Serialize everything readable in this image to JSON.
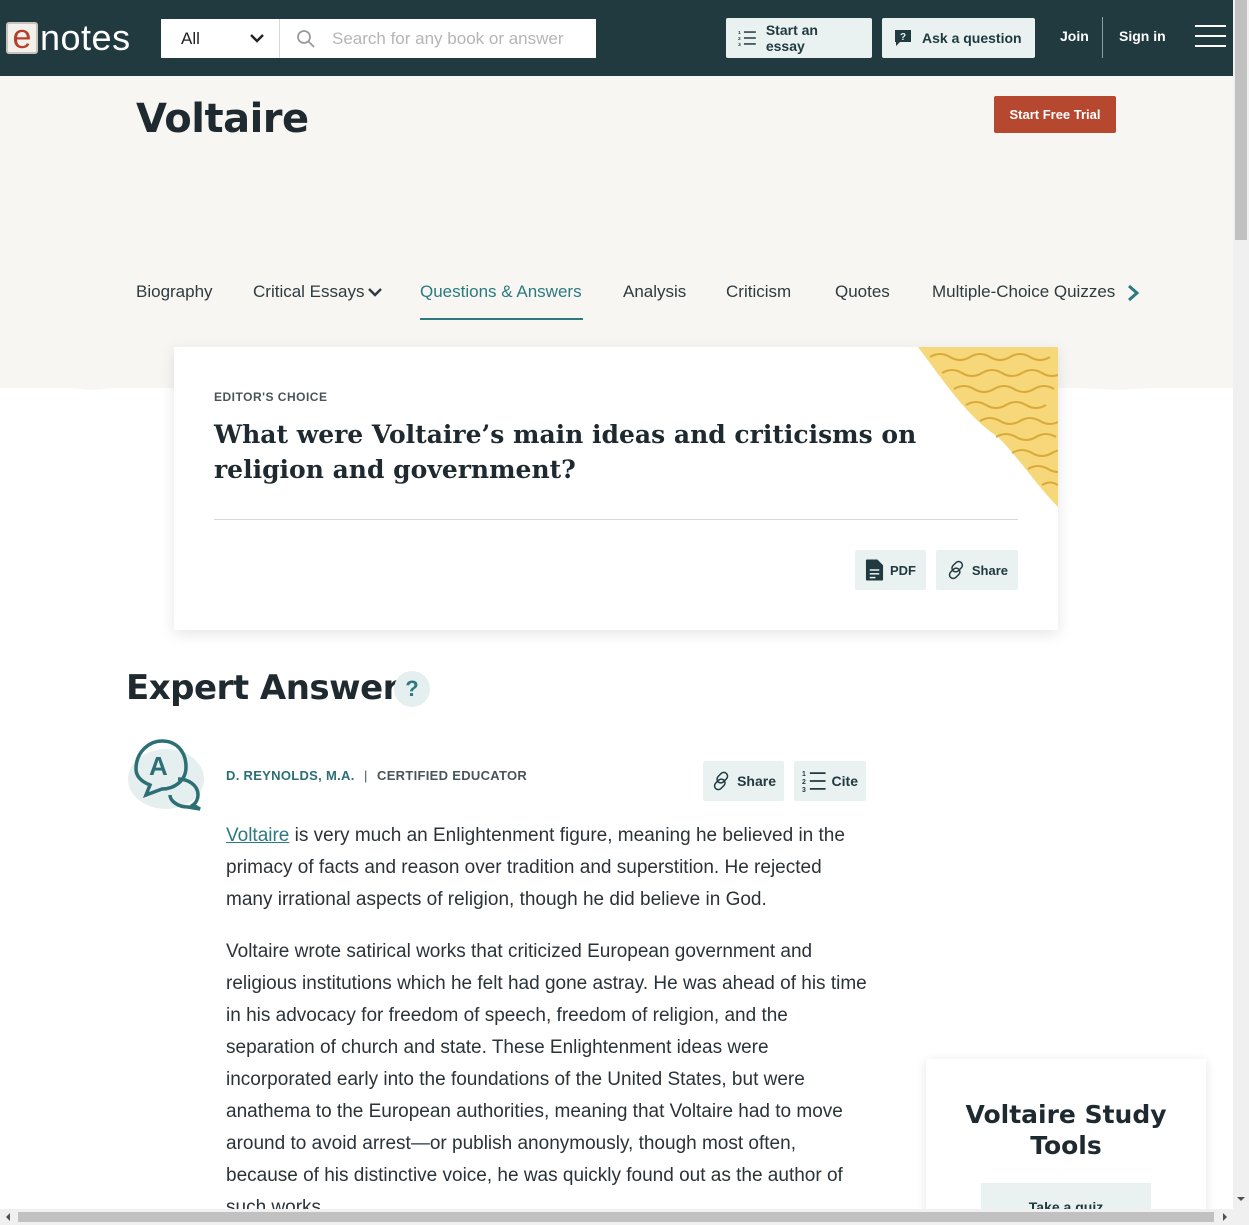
{
  "header": {
    "logo_e": "e",
    "logo_text": "notes",
    "category": "All",
    "search_placeholder": "Search for any book or answer",
    "start_essay": "Start an essay",
    "ask_question": "Ask a question",
    "join": "Join",
    "sign_in": "Sign in"
  },
  "hero": {
    "title": "Voltaire",
    "trial_button": "Start Free Trial",
    "tabs": [
      {
        "label": "Biography"
      },
      {
        "label": "Critical Essays"
      },
      {
        "label": "Questions & Answers"
      },
      {
        "label": "Analysis"
      },
      {
        "label": "Criticism"
      },
      {
        "label": "Quotes"
      },
      {
        "label": "Multiple-Choice Quizzes"
      }
    ]
  },
  "card": {
    "eyebrow": "EDITOR'S CHOICE",
    "question": "What were Voltaire’s main ideas and criticisms on religion and government?",
    "pdf": "PDF",
    "share": "Share"
  },
  "answers": {
    "heading": "Expert Answers",
    "help": "?",
    "avatar_letter": "A",
    "author": "D. REYNOLDS, M.A.",
    "separator": "|",
    "role": "CERTIFIED EDUCATOR",
    "share": "Share",
    "cite": "Cite",
    "p1_link": "Voltaire",
    "p1_rest": " is very much an Enlightenment figure, meaning he believed in the primacy of facts and reason over tradition and superstition. He rejected many irrational aspects of religion, though he did believe in God.",
    "p2": "Voltaire wrote satirical works that criticized European government and religious institutions which he felt had gone astray. He was ahead of his time in his advocacy for freedom of speech, freedom of religion, and the separation of church and state. These Enlightenment ideas were incorporated early into the foundations of the United States, but were anathema to the European authorities, meaning that Voltaire had to move around to avoid arrest—or publish anonymously, though most often, because of his distinctive voice, he was quickly found out as the author of such works."
  },
  "study_tools": {
    "title": "Voltaire Study Tools",
    "button": "Take a quiz"
  },
  "colors": {
    "header_bg": "#203a40",
    "accent": "#2c7a80",
    "trial": "#b5482f",
    "hero_bg": "#f7f6f2",
    "deco": "#f6d77a"
  }
}
